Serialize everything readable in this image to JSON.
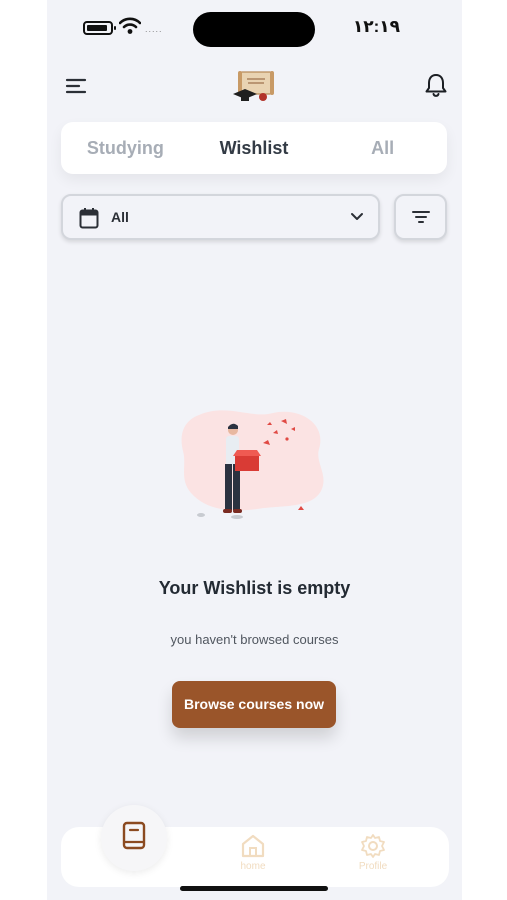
{
  "status_bar": {
    "time": "١٢:١٩",
    "signal_dots": "....."
  },
  "tabs": [
    {
      "label": "Studying",
      "active": false
    },
    {
      "label": "Wishlist",
      "active": true
    },
    {
      "label": "All",
      "active": false
    }
  ],
  "filter": {
    "selected": "All"
  },
  "empty_state": {
    "title": "Your Wishlist is empty",
    "subtitle": "you haven't browsed courses",
    "button_label": "Browse courses now"
  },
  "bottom_nav": {
    "home_label": "home",
    "profile_label": "Profile"
  },
  "colors": {
    "accent": "#9a552a",
    "background": "#f2f3f8",
    "tab_active": "#333b45",
    "tab_inactive": "#a7adb6",
    "nav_inactive": "#f1dcc0"
  },
  "icons": [
    "battery-icon",
    "wifi-icon",
    "menu-icon",
    "logo",
    "bell-icon",
    "calendar-icon",
    "chevron-down-icon",
    "filter-icon",
    "book-icon",
    "home-icon",
    "gear-icon"
  ]
}
